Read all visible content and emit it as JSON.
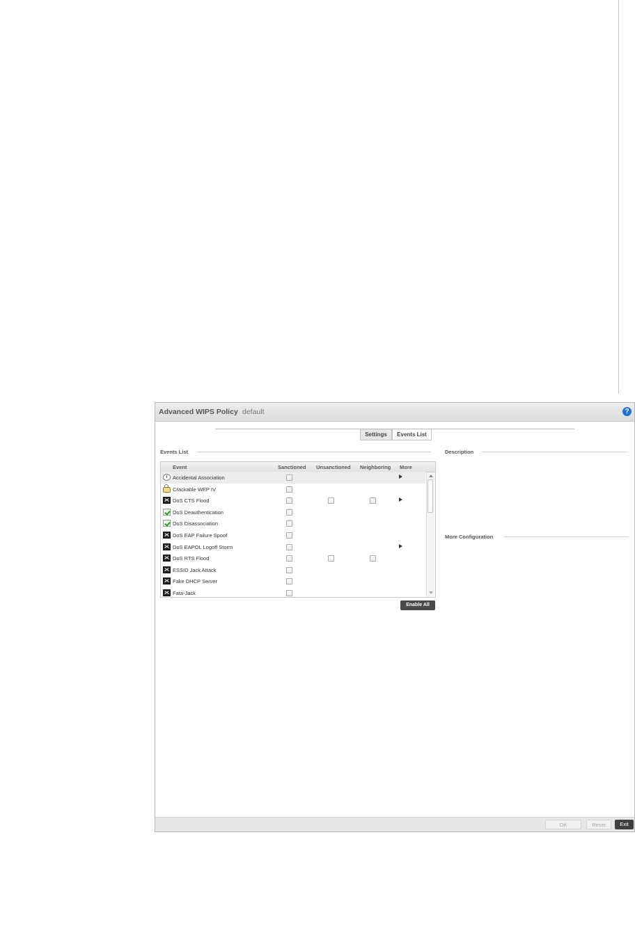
{
  "window": {
    "title": "Advanced WIPS Policy",
    "policy_name": "default",
    "help_icon": "?"
  },
  "tabs": [
    {
      "label": "Settings",
      "active": true
    },
    {
      "label": "Events List",
      "active": false
    }
  ],
  "events_section": {
    "label": "Events List",
    "columns": [
      "Event",
      "Sanctioned",
      "Unsanctioned",
      "Neighboring",
      "More"
    ],
    "rows": [
      {
        "name": "Accidental Association",
        "icon": "clock-icon",
        "sanctioned": true,
        "unsanctioned": false,
        "neighboring": false,
        "more": true,
        "selected": true
      },
      {
        "name": "Crackable WEP IV",
        "icon": "lock-icon",
        "sanctioned": true,
        "unsanctioned": false,
        "neighboring": false,
        "more": false
      },
      {
        "name": "DoS CTS Flood",
        "icon": "dos-icon",
        "sanctioned": true,
        "unsanctioned": true,
        "neighboring": true,
        "more": true
      },
      {
        "name": "DoS Deauthentication",
        "icon": "check-icon",
        "sanctioned": true,
        "unsanctioned": false,
        "neighboring": false,
        "more": false
      },
      {
        "name": "DoS Disassociation",
        "icon": "check-icon",
        "sanctioned": true,
        "unsanctioned": false,
        "neighboring": false,
        "more": false
      },
      {
        "name": "DoS EAP Failure Spoof",
        "icon": "dos-icon",
        "sanctioned": true,
        "unsanctioned": false,
        "neighboring": false,
        "more": false
      },
      {
        "name": "DoS EAPOL Logoff Storm",
        "icon": "dos-icon",
        "sanctioned": true,
        "unsanctioned": false,
        "neighboring": false,
        "more": true
      },
      {
        "name": "DoS RTS Flood",
        "icon": "dos-icon",
        "sanctioned": true,
        "unsanctioned": true,
        "neighboring": true,
        "more": false
      },
      {
        "name": "ESSID Jack Attack",
        "icon": "dos-icon",
        "sanctioned": true,
        "unsanctioned": false,
        "neighboring": false,
        "more": false
      },
      {
        "name": "Fake DHCP Server",
        "icon": "dos-icon",
        "sanctioned": true,
        "unsanctioned": false,
        "neighboring": false,
        "more": false
      },
      {
        "name": "Fata-Jack",
        "icon": "dos-icon",
        "sanctioned": true,
        "unsanctioned": false,
        "neighboring": false,
        "more": false
      }
    ],
    "enable_all_label": "Enable All"
  },
  "description_section": {
    "label": "Description"
  },
  "more_config_section": {
    "label": "More Configuration"
  },
  "footer": {
    "ok_label": "OK",
    "reset_label": "Reset",
    "exit_label": "Exit"
  }
}
